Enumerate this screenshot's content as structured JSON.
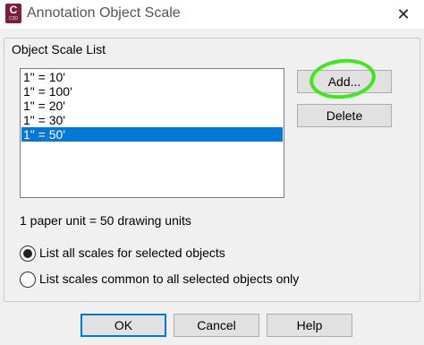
{
  "window": {
    "title": "Annotation Object Scale",
    "icon_letter": "C",
    "icon_sub": "C3D",
    "close_glyph": "✕"
  },
  "group": {
    "label": "Object Scale List"
  },
  "scale_list": {
    "items": [
      "1\" = 10'",
      "1\" = 100'",
      "1\" = 20'",
      "1\" = 30'",
      "1\" = 50'"
    ],
    "selected_index": 4
  },
  "buttons": {
    "add": "Add...",
    "delete": "Delete",
    "ok": "OK",
    "cancel": "Cancel",
    "help": "Help"
  },
  "status_text": "1 paper unit = 50 drawing units",
  "radios": [
    {
      "label": "List all scales for selected objects",
      "checked": true
    },
    {
      "label": "List scales common to all selected objects only",
      "checked": false
    }
  ],
  "colors": {
    "selection": "#0078d7",
    "highlight_annotation": "#3ee81a",
    "app_icon": "#7a1f3d"
  }
}
